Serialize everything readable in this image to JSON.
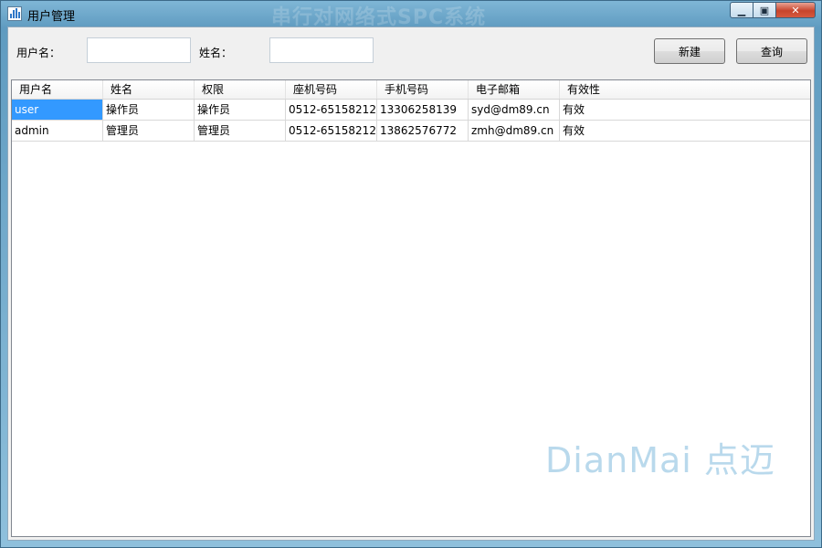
{
  "window": {
    "title": "用户管理",
    "watermark_title": "串行对网络式SPC系统"
  },
  "controls": {
    "minimize": "▁",
    "maximize": "▣",
    "close": "✕"
  },
  "search": {
    "username_label": "用户名：",
    "username_value": "",
    "name_label": "姓名：",
    "name_value": ""
  },
  "buttons": {
    "new": "新建",
    "query": "查询"
  },
  "table": {
    "columns": [
      "用户名",
      "姓名",
      "权限",
      "座机号码",
      "手机号码",
      "电子邮箱",
      "有效性"
    ],
    "rows": [
      [
        "user",
        "操作员",
        "操作员",
        "0512-65158212",
        "13306258139",
        "syd@dm89.cn",
        "有效"
      ],
      [
        "admin",
        "管理员",
        "管理员",
        "0512-65158212",
        "13862576772",
        "zmh@dm89.cn",
        "有效"
      ]
    ]
  },
  "watermark": "DianMai 点迈"
}
